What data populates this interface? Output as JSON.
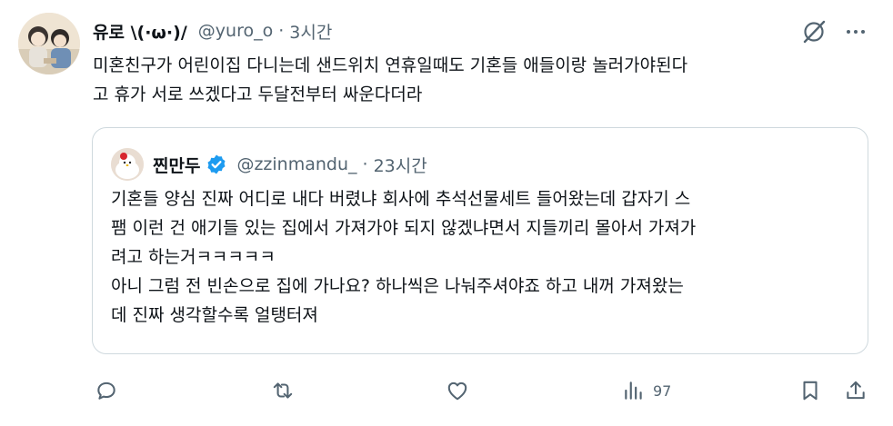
{
  "tweet": {
    "display_name": "유로 \\(·ω·)/",
    "handle": "@yuro_o",
    "separator": "·",
    "time": "3시간",
    "text": "미혼친구가 어린이집 다니는데 샌드위치 연휴일때도 기혼들 애들이랑 놀러가야된다\n고 휴가 서로 쓰겠다고 두달전부터 싸운다더라"
  },
  "quote": {
    "display_name": "찐만두",
    "handle": "@zzinmandu_",
    "separator": "·",
    "time": "23시간",
    "text": "기혼들 양심 진짜 어디로 내다 버렸냐 회사에 추석선물세트 들어왔는데 갑자기 스\n팸 이런 건 애기들 있는 집에서 가져가야 되지 않겠냐면서 지들끼리 몰아서 가져가\n려고 하는거ㅋㅋㅋㅋㅋ\n아니 그럼 전 빈손으로 집에 가나요? 하나씩은 나눠주셔야죠 하고 내꺼 가져왔는\n데 진짜 생각할수록 얼탱터져"
  },
  "actions": {
    "views": "97"
  },
  "colors": {
    "text": "#0f1419",
    "secondary": "#536471",
    "verified": "#1d9bf0",
    "border": "#cfd9de"
  },
  "icons": [
    "grok-icon",
    "more-icon",
    "verified-badge-icon",
    "reply-icon",
    "retweet-icon",
    "like-icon",
    "views-icon",
    "bookmark-icon",
    "share-icon"
  ]
}
